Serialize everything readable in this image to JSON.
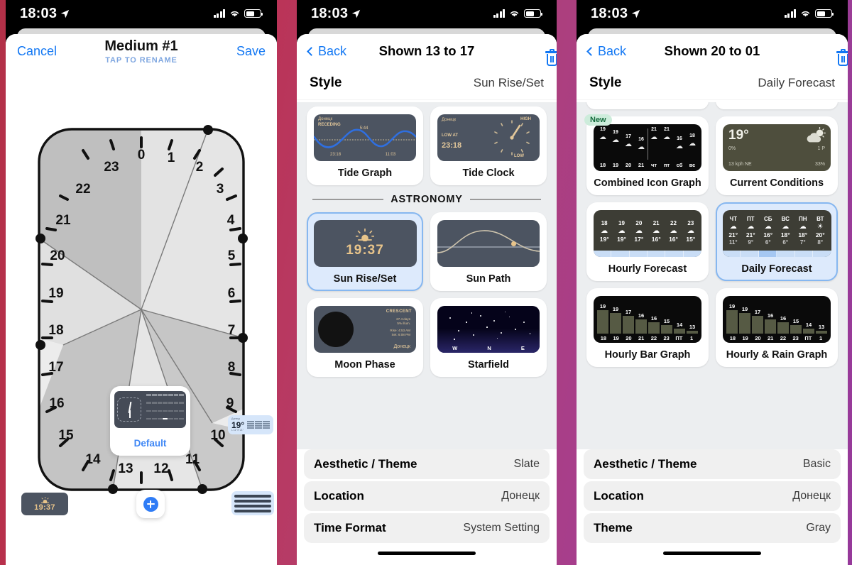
{
  "status_bar": {
    "time": "18:03",
    "icons": [
      "location-arrow",
      "cellular-signal",
      "wifi",
      "battery"
    ]
  },
  "phone1": {
    "nav": {
      "cancel": "Cancel",
      "title": "Medium #1",
      "subtitle": "TAP TO RENAME",
      "save": "Save"
    },
    "dial": {
      "hours": [
        "0",
        "1",
        "2",
        "3",
        "4",
        "5",
        "6",
        "7",
        "8",
        "9",
        "10",
        "11",
        "12",
        "13",
        "14",
        "15",
        "16",
        "17",
        "18",
        "19",
        "20",
        "21",
        "22",
        "23"
      ]
    },
    "widget_card": {
      "label": "Default"
    },
    "mini_widgets": [
      {
        "name": "calendar-grid-widget"
      },
      {
        "name": "sun-time-widget",
        "value": "19:37"
      },
      {
        "name": "weather-temp-widget",
        "value": "19°"
      },
      {
        "name": "lines-widget"
      }
    ],
    "add_button": "+"
  },
  "phone2": {
    "nav": {
      "back": "Back",
      "title": "Shown 13 to 17",
      "delete": "delete-icon"
    },
    "style": {
      "label": "Style",
      "value": "Sun Rise/Set"
    },
    "section_header": "ASTRONOMY",
    "cards_top": [
      {
        "caption": "Tide Graph",
        "selected": false,
        "preview": {
          "location": "Донецк",
          "state": "RECEDING",
          "peak": "5:44",
          "low_left": "23:18",
          "low_right": "11:03"
        }
      },
      {
        "caption": "Tide Clock",
        "selected": false,
        "preview": {
          "location": "Донецк",
          "low_label": "LOW AT",
          "low_time": "23:18",
          "high": "HIGH",
          "low": "LOW"
        }
      }
    ],
    "cards_astronomy": [
      {
        "caption": "Sun Rise/Set",
        "selected": true,
        "preview": {
          "time": "19:37"
        }
      },
      {
        "caption": "Sun Path",
        "selected": false,
        "preview": {}
      },
      {
        "caption": "Moon Phase",
        "selected": false,
        "preview": {
          "phase": "CRESCENT",
          "age": "27.4 days",
          "illum": "5% illum.",
          "rise": "Rise: 4:53 AM",
          "set": "Set: 6:08 PM",
          "location": "Донецк"
        }
      },
      {
        "caption": "Starfield",
        "selected": false,
        "preview": {
          "dirs": [
            "W",
            "N",
            "E"
          ]
        }
      }
    ],
    "settings": [
      {
        "key": "Aesthetic / Theme",
        "value": "Slate"
      },
      {
        "key": "Location",
        "value": "Донецк"
      },
      {
        "key": "Time Format",
        "value": "System Setting"
      }
    ]
  },
  "phone3": {
    "nav": {
      "back": "Back",
      "title": "Shown 20 to 01",
      "delete": "delete-icon"
    },
    "style": {
      "label": "Style",
      "value": "Daily Forecast"
    },
    "cards": [
      {
        "caption": "Combined Icon Graph",
        "selected": false,
        "badge": "New",
        "preview": {
          "left_hours": [
            "18",
            "19",
            "20",
            "21"
          ],
          "left_temps": [
            "19",
            "19",
            "17",
            "16"
          ],
          "right_days": [
            "чт",
            "пт",
            "сб",
            "вс"
          ],
          "right_temps": [
            "21",
            "21",
            "16",
            "18"
          ]
        }
      },
      {
        "caption": "Current Conditions",
        "selected": false,
        "preview": {
          "temp": "19°",
          "precip": "0%",
          "wind": "13 kph NE",
          "humidity": "33%",
          "feels": "1 P"
        }
      },
      {
        "caption": "Hourly Forecast",
        "selected": false,
        "preview": {
          "hours": [
            "18",
            "19",
            "20",
            "21",
            "22",
            "23"
          ],
          "temps": [
            "19°",
            "19°",
            "17°",
            "16°",
            "16°",
            "15°"
          ]
        }
      },
      {
        "caption": "Daily Forecast",
        "selected": true,
        "preview": {
          "days": [
            "ЧТ",
            "ПТ",
            "СБ",
            "ВС",
            "ПН",
            "ВТ"
          ],
          "highs": [
            "21°",
            "21°",
            "16°",
            "18°",
            "18°",
            "20°"
          ],
          "lows": [
            "11°",
            "9°",
            "6°",
            "6°",
            "7°",
            "8°"
          ]
        }
      },
      {
        "caption": "Hourly Bar Graph",
        "selected": false,
        "preview": {
          "labels": [
            "18",
            "19",
            "20",
            "21",
            "22",
            "23",
            "ПТ",
            "1"
          ],
          "values": [
            19,
            19,
            17,
            16,
            16,
            15,
            14,
            13
          ]
        }
      },
      {
        "caption": "Hourly & Rain Graph",
        "selected": false,
        "preview": {
          "labels": [
            "18",
            "19",
            "20",
            "21",
            "22",
            "23",
            "ПТ",
            "1"
          ],
          "values": [
            19,
            19,
            17,
            16,
            16,
            15,
            14,
            13
          ]
        }
      }
    ],
    "settings": [
      {
        "key": "Aesthetic / Theme",
        "value": "Basic"
      },
      {
        "key": "Location",
        "value": "Донецк"
      },
      {
        "key": "Theme",
        "value": "Gray"
      }
    ]
  },
  "colors": {
    "accent": "#1277f3",
    "selected_card_bg": "#ddeafc",
    "selected_card_border": "#86b7f0",
    "badge_new_bg": "#cdecdb"
  }
}
